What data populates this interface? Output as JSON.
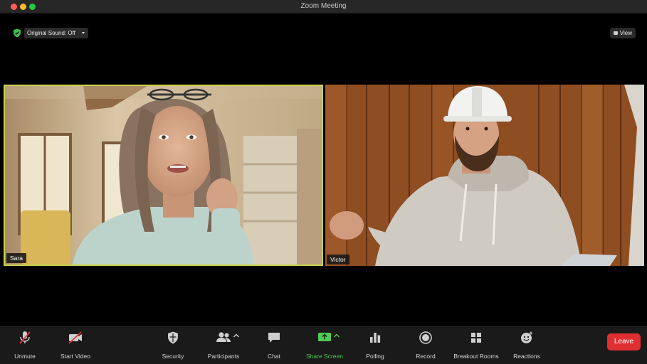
{
  "window": {
    "title": "Zoom Meeting"
  },
  "top_bar": {
    "original_sound_label": "Original Sound: Off",
    "view_label": "View"
  },
  "participants": [
    {
      "name": "Sara",
      "active_speaker": true
    },
    {
      "name": "Victor",
      "active_speaker": false
    }
  ],
  "toolbar": {
    "unmute_label": "Unmute",
    "start_video_label": "Start Video",
    "security_label": "Security",
    "participants_label": "Participants",
    "chat_label": "Chat",
    "share_screen_label": "Share Screen",
    "polling_label": "Polling",
    "record_label": "Record",
    "breakout_rooms_label": "Breakout Rooms",
    "reactions_label": "Reactions",
    "leave_label": "Leave"
  },
  "colors": {
    "active_speaker_border": "#c8d14f",
    "share_screen_green": "#4ecb53",
    "leave_red": "#e02f33",
    "security_shield_green": "#3fbf4a"
  }
}
